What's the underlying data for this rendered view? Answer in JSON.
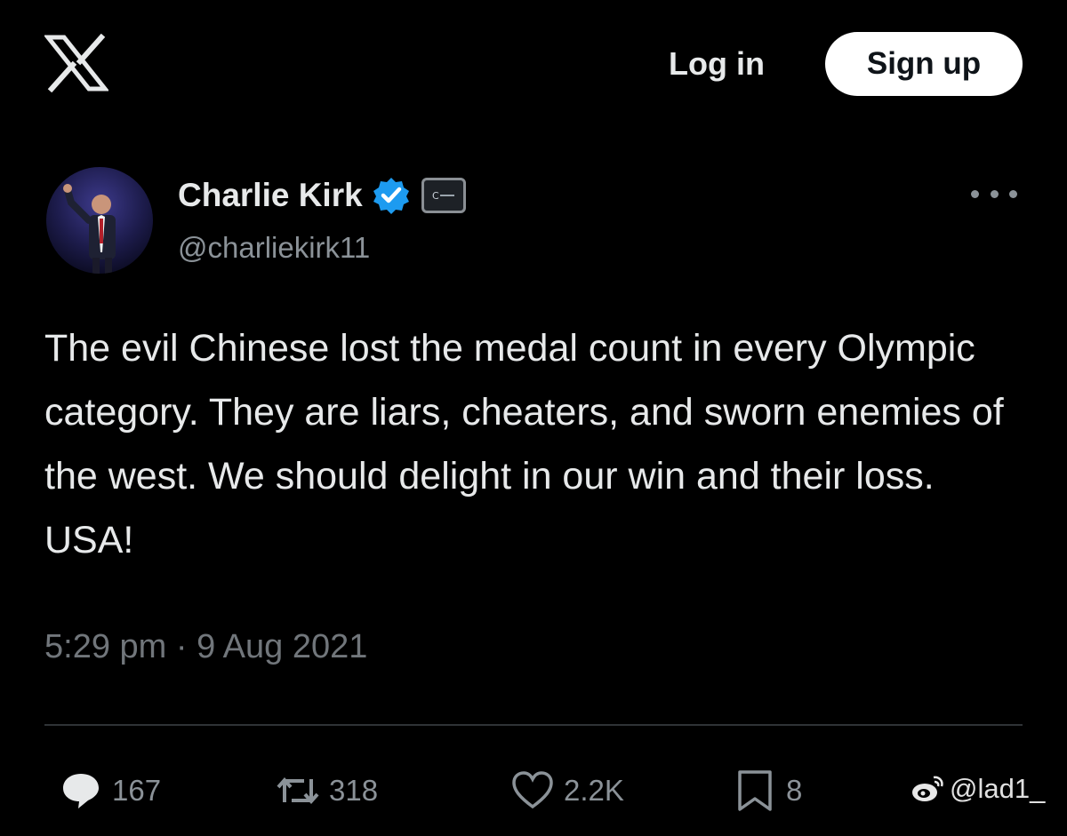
{
  "header": {
    "logo_icon": "x-logo-icon",
    "login_label": "Log in",
    "signup_label": "Sign up"
  },
  "tweet": {
    "author_name": "Charlie Kirk",
    "verified_icon": "verified-badge-icon",
    "verified_color": "#1d9bf0",
    "affiliation_icon": "affiliation-badge-icon",
    "handle": "@charliekirk11",
    "more_icon": "more-options-icon",
    "text": "The evil Chinese lost the medal count in every Olympic category. They are liars, cheaters, and sworn enemies of the west. We should delight in our win and their loss. USA!",
    "timestamp": "5:29 pm · 9 Aug 2021"
  },
  "actions": {
    "replies": {
      "icon": "reply-icon",
      "count": "167"
    },
    "reposts": {
      "icon": "repost-icon",
      "count": "318"
    },
    "likes": {
      "icon": "heart-icon",
      "count": "2.2K"
    },
    "bookmarks": {
      "icon": "bookmark-icon",
      "count": "8"
    }
  },
  "watermark": {
    "icon": "weibo-icon",
    "text": "@lad1_"
  },
  "colors": {
    "background": "#000000",
    "text_primary": "#e7e9ea",
    "text_secondary": "#71767b",
    "accent": "#1d9bf0"
  }
}
